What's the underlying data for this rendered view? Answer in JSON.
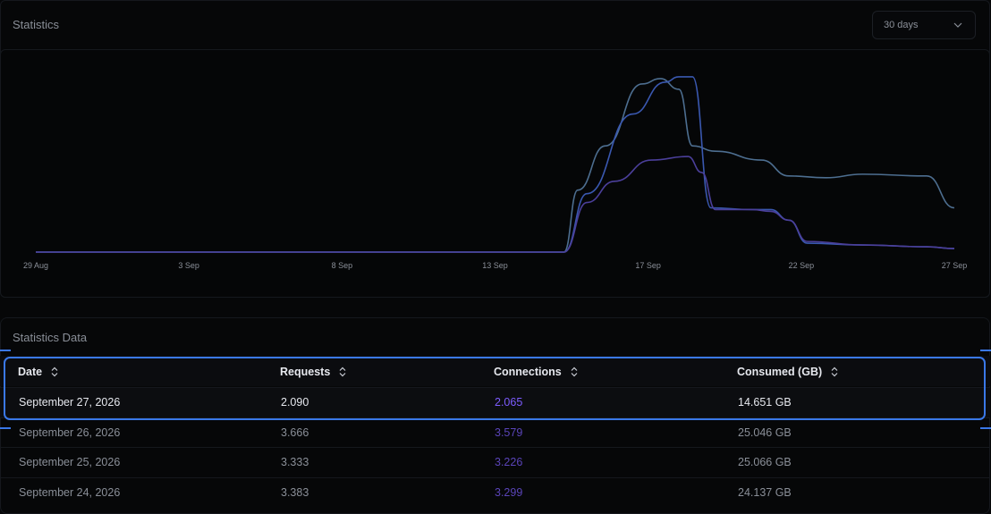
{
  "statistics": {
    "title": "Statistics",
    "range_select": {
      "value": "30 days"
    }
  },
  "chart_data": {
    "type": "line",
    "x_labels": [
      "29 Aug",
      "3 Sep",
      "8 Sep",
      "13 Sep",
      "17 Sep",
      "22 Sep",
      "27 Sep"
    ],
    "series": [
      {
        "color": "#4d6e90",
        "points": [
          [
            0,
            0
          ],
          [
            0.2,
            0
          ],
          [
            0.4,
            0
          ],
          [
            0.55,
            0
          ],
          [
            0.575,
            0
          ],
          [
            0.59,
            0.35
          ],
          [
            0.62,
            0.6
          ],
          [
            0.66,
            0.95
          ],
          [
            0.68,
            0.98
          ],
          [
            0.7,
            0.92
          ],
          [
            0.715,
            0.6
          ],
          [
            0.74,
            0.57
          ],
          [
            0.79,
            0.52
          ],
          [
            0.82,
            0.43
          ],
          [
            0.86,
            0.42
          ],
          [
            0.9,
            0.44
          ],
          [
            0.97,
            0.43
          ],
          [
            1.0,
            0.25
          ]
        ]
      },
      {
        "color": "#3a58b0",
        "points": [
          [
            0,
            0
          ],
          [
            0.2,
            0
          ],
          [
            0.4,
            0
          ],
          [
            0.55,
            0
          ],
          [
            0.575,
            0
          ],
          [
            0.6,
            0.33
          ],
          [
            0.65,
            0.78
          ],
          [
            0.685,
            0.96
          ],
          [
            0.7,
            0.99
          ],
          [
            0.715,
            0.99
          ],
          [
            0.735,
            0.25
          ],
          [
            0.78,
            0.24
          ],
          [
            0.8,
            0.24
          ],
          [
            0.82,
            0.18
          ],
          [
            0.84,
            0.05
          ],
          [
            0.9,
            0.04
          ],
          [
            0.97,
            0.03
          ],
          [
            1.0,
            0.02
          ]
        ]
      },
      {
        "color": "#4b3f9a",
        "points": [
          [
            0,
            0
          ],
          [
            0.2,
            0
          ],
          [
            0.4,
            0
          ],
          [
            0.55,
            0
          ],
          [
            0.575,
            0
          ],
          [
            0.6,
            0.28
          ],
          [
            0.63,
            0.4
          ],
          [
            0.67,
            0.52
          ],
          [
            0.71,
            0.54
          ],
          [
            0.725,
            0.45
          ],
          [
            0.74,
            0.24
          ],
          [
            0.78,
            0.24
          ],
          [
            0.8,
            0.23
          ],
          [
            0.82,
            0.18
          ],
          [
            0.84,
            0.06
          ],
          [
            0.9,
            0.04
          ],
          [
            0.97,
            0.03
          ],
          [
            1.0,
            0.02
          ]
        ]
      }
    ]
  },
  "table": {
    "title": "Statistics Data",
    "headers": [
      "Date",
      "Requests",
      "Connections",
      "Consumed (GB)"
    ],
    "rows": [
      {
        "date": "September 27, 2026",
        "requests": "2.090",
        "connections": "2.065",
        "consumed": "14.651 GB"
      },
      {
        "date": "September 26, 2026",
        "requests": "3.666",
        "connections": "3.579",
        "consumed": "25.046 GB"
      },
      {
        "date": "September 25, 2026",
        "requests": "3.333",
        "connections": "3.226",
        "consumed": "25.066 GB"
      },
      {
        "date": "September 24, 2026",
        "requests": "3.383",
        "connections": "3.299",
        "consumed": "24.137 GB"
      }
    ]
  }
}
